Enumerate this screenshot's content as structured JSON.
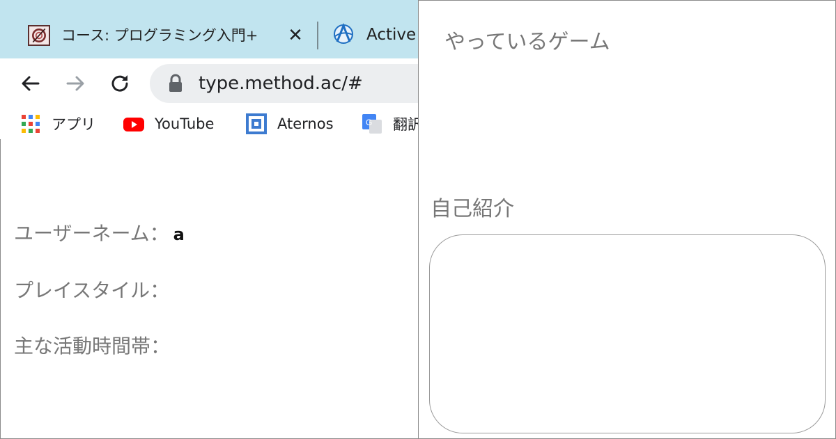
{
  "browser": {
    "tabs": [
      {
        "title": "コース: プログラミング入門+",
        "favicon": "course-favicon",
        "active": true
      },
      {
        "title": "Active",
        "favicon": "globe-a-favicon",
        "active": false
      }
    ],
    "close_glyph": "✕",
    "address_bar": {
      "url": "type.method.ac/#"
    },
    "bookmarks": [
      {
        "label": "アプリ",
        "icon": "apps-grid-icon"
      },
      {
        "label": "YouTube",
        "icon": "youtube-icon"
      },
      {
        "label": "Aternos",
        "icon": "aternos-icon"
      },
      {
        "label": "翻訳",
        "icon": "google-translate-icon"
      }
    ],
    "colors": {
      "tabstrip": "#c1e4ef",
      "omnibox": "#eceef0"
    }
  },
  "profile": {
    "fields": [
      {
        "label": "ユーザーネーム：",
        "value": "a"
      },
      {
        "label": "プレイスタイル：",
        "value": ""
      },
      {
        "label": "主な活動時間帯：",
        "value": ""
      }
    ],
    "games_heading": "やっているゲーム",
    "intro_heading": "自己紹介",
    "intro_value": ""
  }
}
